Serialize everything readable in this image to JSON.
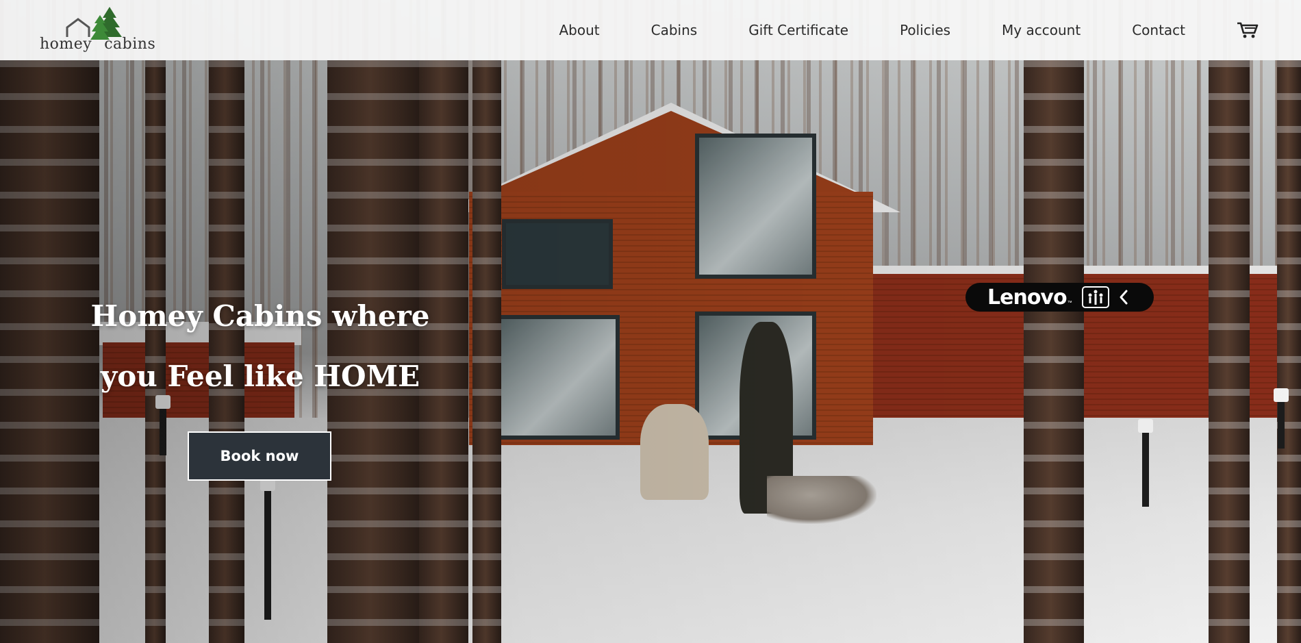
{
  "logo": {
    "word1": "homey",
    "word2": "cabins",
    "icon": "house-and-pine-trees-logo"
  },
  "nav": {
    "items": [
      {
        "label": "About"
      },
      {
        "label": "Cabins"
      },
      {
        "label": "Gift Certificate"
      },
      {
        "label": "Policies"
      },
      {
        "label": "My account"
      },
      {
        "label": "Contact"
      }
    ],
    "cart_icon": "shopping-cart-icon"
  },
  "hero": {
    "title_line1": "Homey Cabins where",
    "title_line2": "you Feel like HOME",
    "cta_label": "Book now",
    "background": "snowy-forest-cabin-photo"
  },
  "overlay_badge": {
    "brand": "Lenovo",
    "trademark": "™",
    "icon": "lenovo-vantage-icon",
    "collapse_icon": "chevron-left-icon"
  },
  "colors": {
    "header_bg": "#f6f6f6",
    "nav_text": "#2b2b2b",
    "button_bg": "#2c333a",
    "button_border": "#ffffff",
    "hero_text": "#ffffff",
    "logo_tree": "#2f6b2c"
  }
}
